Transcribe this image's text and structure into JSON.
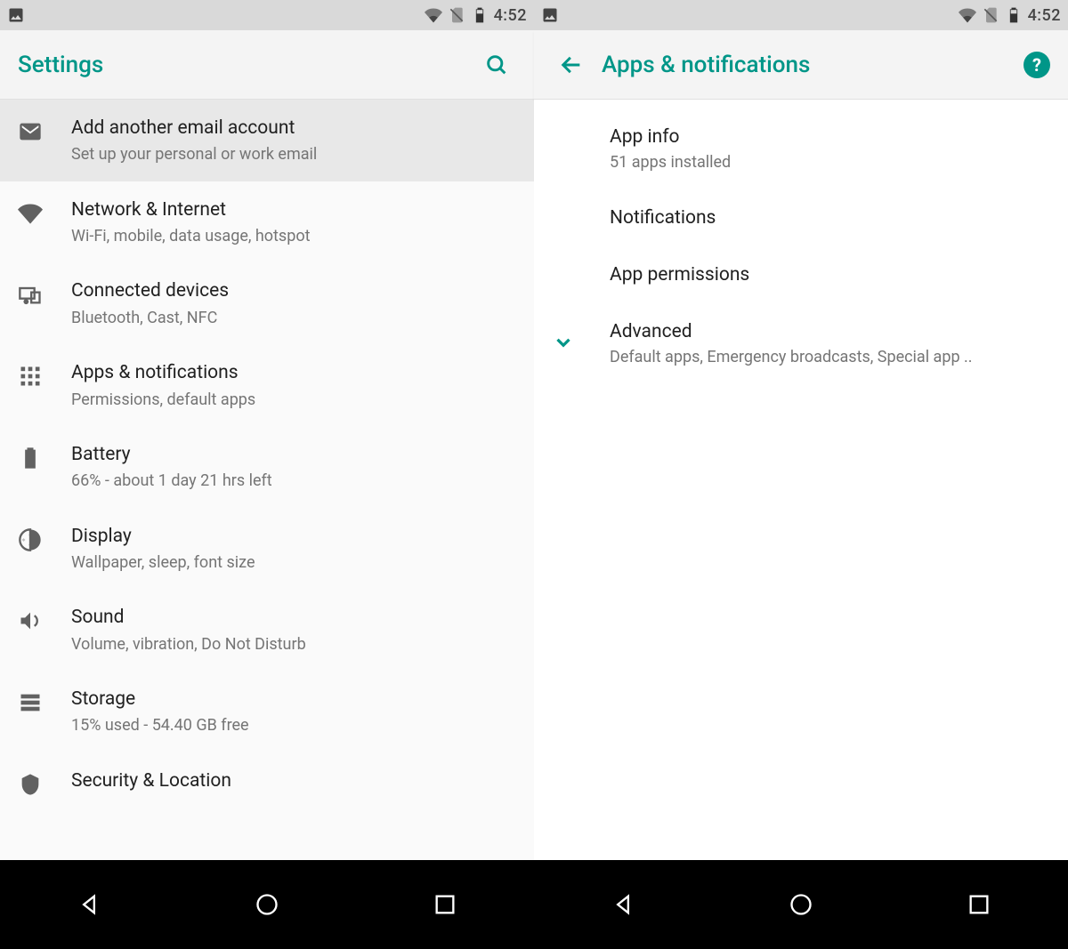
{
  "status": {
    "clock": "4:52"
  },
  "left": {
    "title": "Settings",
    "rows": [
      {
        "icon": "gmail",
        "title": "Add another email account",
        "sub": "Set up your personal or work email",
        "highlight": true
      },
      {
        "icon": "wifi",
        "title": "Network & Internet",
        "sub": "Wi-Fi, mobile, data usage, hotspot"
      },
      {
        "icon": "devices",
        "title": "Connected devices",
        "sub": "Bluetooth, Cast, NFC"
      },
      {
        "icon": "apps",
        "title": "Apps & notifications",
        "sub": "Permissions, default apps"
      },
      {
        "icon": "battery",
        "title": "Battery",
        "sub": "66% - about 1 day 21 hrs left"
      },
      {
        "icon": "display",
        "title": "Display",
        "sub": "Wallpaper, sleep, font size"
      },
      {
        "icon": "sound",
        "title": "Sound",
        "sub": "Volume, vibration, Do Not Disturb"
      },
      {
        "icon": "storage",
        "title": "Storage",
        "sub": "15% used - 54.40 GB free"
      },
      {
        "icon": "security",
        "title": "Security & Location",
        "sub": ""
      }
    ]
  },
  "right": {
    "title": "Apps & notifications",
    "rows": [
      {
        "title": "App info",
        "sub": "51 apps installed"
      },
      {
        "title": "Notifications",
        "sub": ""
      },
      {
        "title": "App permissions",
        "sub": ""
      },
      {
        "title": "Advanced",
        "sub": "Default apps, Emergency broadcasts, Special app ..",
        "expand": true
      }
    ]
  },
  "accent": "#009688"
}
